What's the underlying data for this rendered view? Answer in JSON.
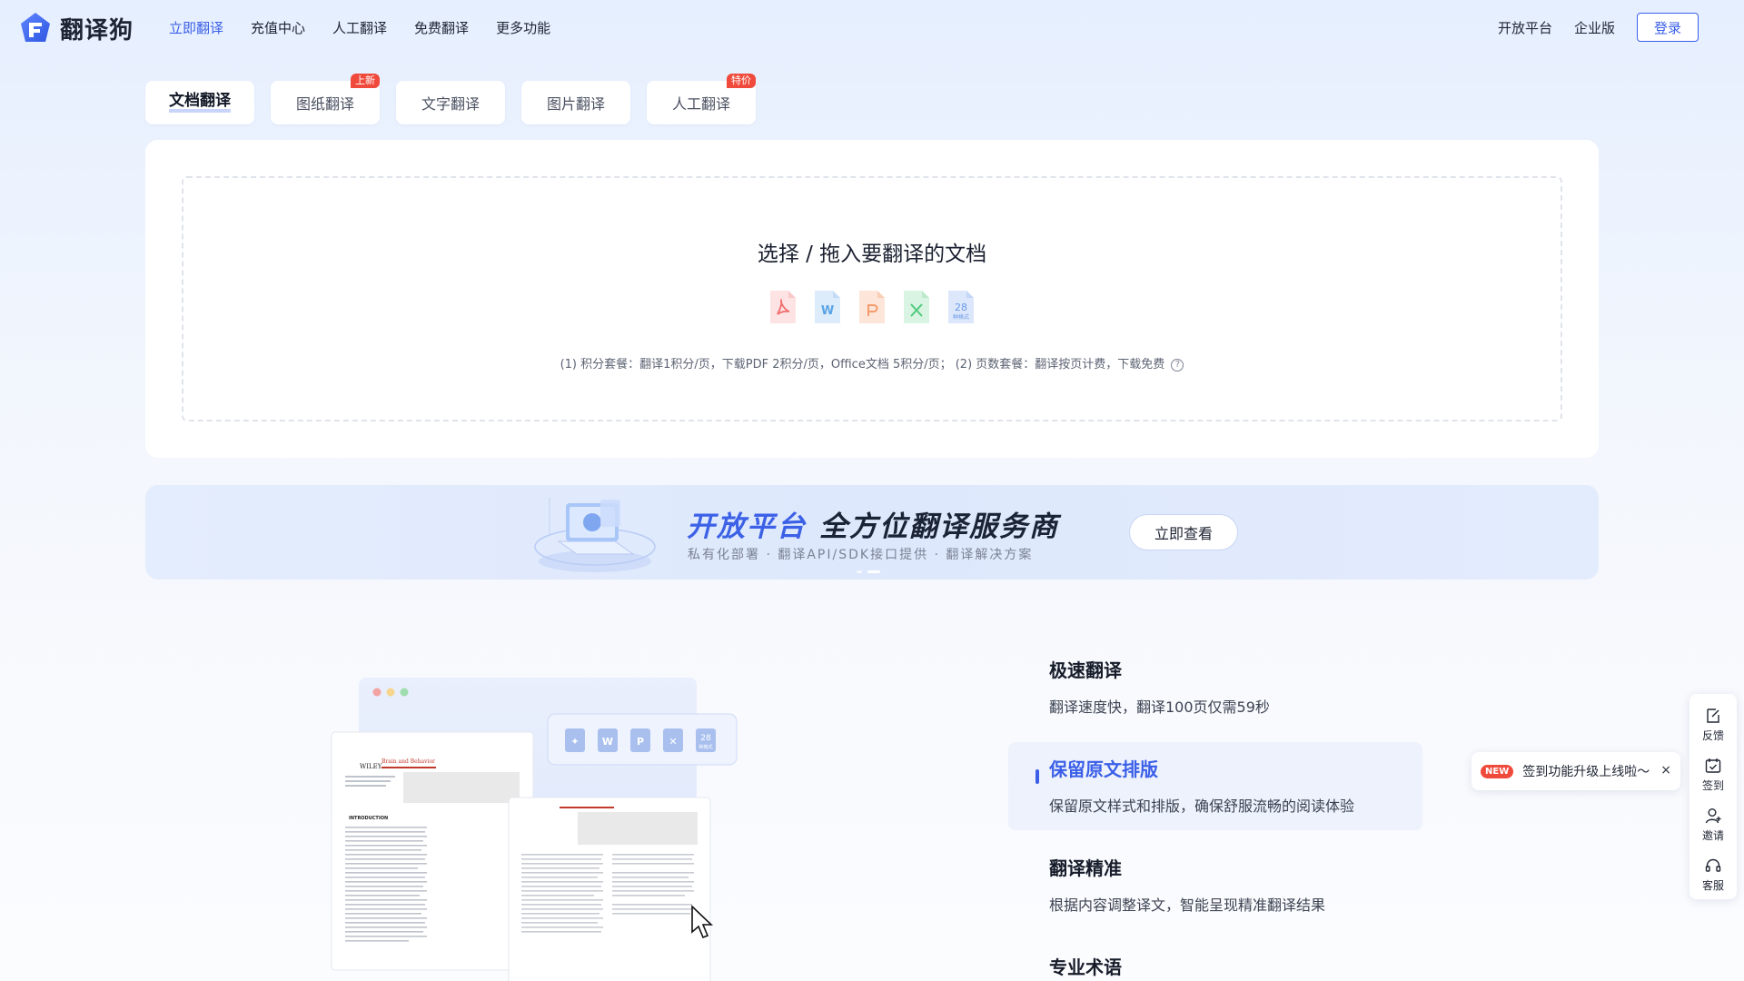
{
  "brand": {
    "name": "翻译狗",
    "accent": "#3b5fe8"
  },
  "nav": {
    "items": [
      {
        "label": "立即翻译",
        "active": true
      },
      {
        "label": "充值中心"
      },
      {
        "label": "人工翻译"
      },
      {
        "label": "免费翻译"
      },
      {
        "label": "更多功能"
      }
    ],
    "right": {
      "open_platform": "开放平台",
      "enterprise": "企业版",
      "login": "登录"
    }
  },
  "tabs": [
    {
      "label": "文档翻译",
      "active": true
    },
    {
      "label": "图纸翻译",
      "badge": "上新"
    },
    {
      "label": "文字翻译"
    },
    {
      "label": "图片翻译"
    },
    {
      "label": "人工翻译",
      "badge": "特价"
    }
  ],
  "upload": {
    "title": "选择 / 拖入要翻译的文档",
    "file_types": [
      "pdf-icon",
      "word-icon",
      "ppt-icon",
      "excel-icon",
      "more-formats-icon"
    ],
    "more_formats": {
      "count": "28",
      "label": "种格式"
    },
    "note": "(1) 积分套餐：翻译1积分/页，下载PDF 2积分/页，Office文档 5积分/页； (2) 页数套餐：翻译按页计费，下载免费",
    "help": "?"
  },
  "banner": {
    "title_accent": "开放平台",
    "title_main": "全方位翻译服务商",
    "subtitle": "私有化部署 · 翻译API/SDK接口提供 · 翻译解决方案",
    "button": "立即查看"
  },
  "illustration": {
    "doc_brand": "WILEY",
    "doc_journal": "Brain and Behavior",
    "doc_heading": "INTRODUCTION",
    "file_card_count": "28",
    "file_card_label": "种格式"
  },
  "features": [
    {
      "title": "极速翻译",
      "desc": "翻译速度快，翻译100页仅需59秒"
    },
    {
      "title": "保留原文排版",
      "desc": "保留原文样式和排版，确保舒服流畅的阅读体验",
      "active": true
    },
    {
      "title": "翻译精准",
      "desc": "根据内容调整译文，智能呈现精准翻译结果"
    },
    {
      "title": "专业术语",
      "desc": ""
    }
  ],
  "side_bar": [
    {
      "label": "反馈",
      "icon": "feedback-icon"
    },
    {
      "label": "签到",
      "icon": "calendar-check-icon"
    },
    {
      "label": "邀请",
      "icon": "invite-user-icon"
    },
    {
      "label": "客服",
      "icon": "headset-icon"
    }
  ],
  "toast": {
    "badge": "NEW",
    "text": "签到功能升级上线啦～",
    "close": "×"
  },
  "colors": {
    "pdf": "#f26b6b",
    "word": "#5aa4e6",
    "ppt": "#f59a6b",
    "excel": "#4fca7d",
    "more": "#6c9ae8",
    "badge": "#ef4a3c"
  }
}
